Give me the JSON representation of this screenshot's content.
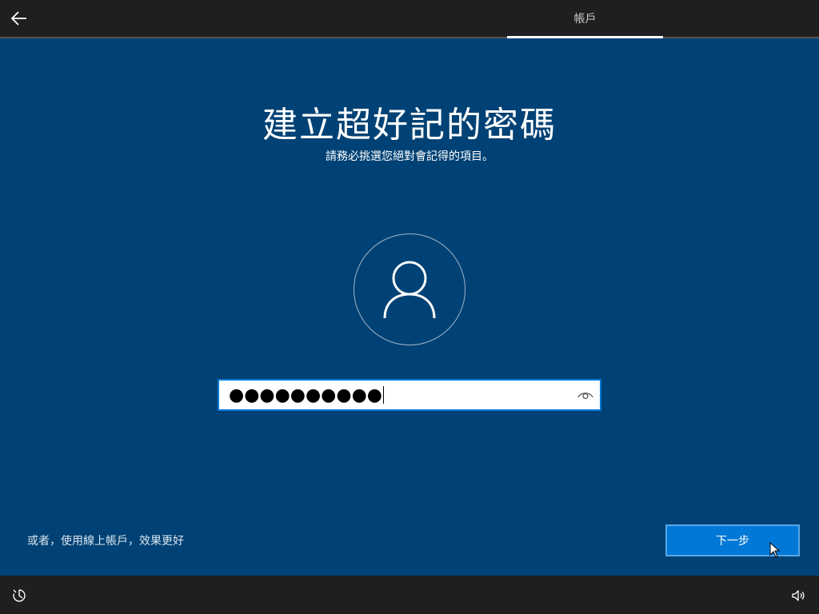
{
  "header": {
    "back_icon": "arrow-left-icon",
    "active_tab": "帳戶"
  },
  "main": {
    "title": "建立超好記的密碼",
    "subtitle": "請務必挑選您絕對會記得的項目。",
    "avatar_icon": "user-icon",
    "password_field": {
      "masked_value": "●●●●●●●●●●",
      "reveal_icon": "eye-icon"
    },
    "online_account_link": "或者，使用線上帳戶，效果更好",
    "next_button": "下一步"
  },
  "footer": {
    "ease_of_access_icon": "ease-of-access-icon",
    "volume_icon": "volume-icon"
  },
  "colors": {
    "background": "#004275",
    "bar": "#1f1f1f",
    "accent": "#0078d7"
  }
}
